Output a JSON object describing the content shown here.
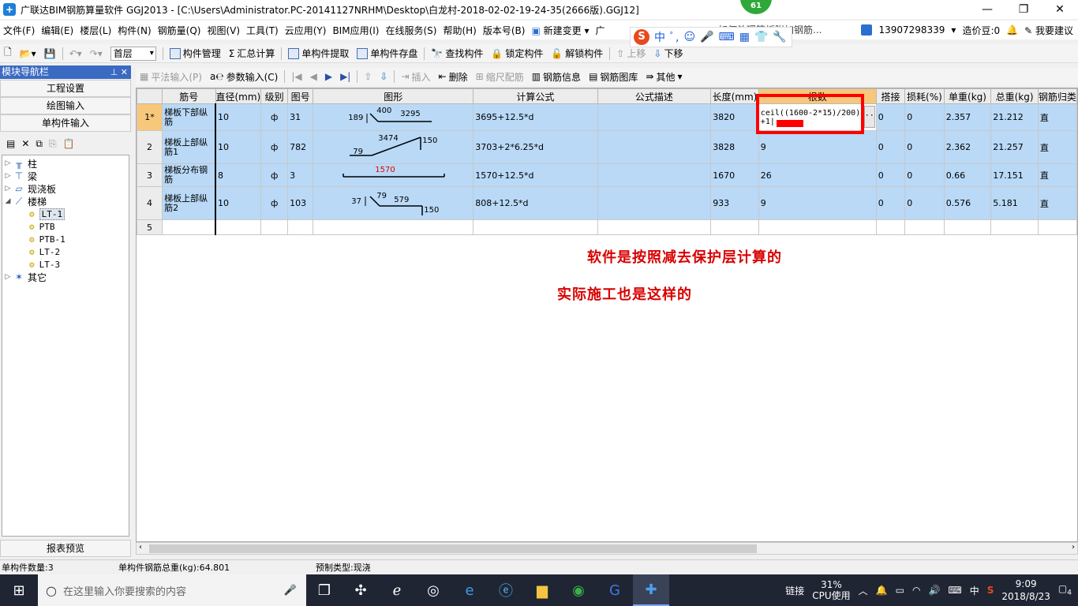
{
  "window": {
    "title": "广联达BIM钢筋算量软件 GGJ2013 - [C:\\Users\\Administrator.PC-20141127NRHM\\Desktop\\白龙村-2018-02-02-19-24-35(2666版).GGJ12]",
    "badge": "61"
  },
  "menu": {
    "items": [
      "文件(F)",
      "编辑(E)",
      "楼层(L)",
      "构件(N)",
      "钢筋量(Q)",
      "视图(V)",
      "工具(T)",
      "云应用(Y)",
      "BIM应用(I)",
      "在线服务(S)",
      "帮助(H)",
      "版本号(B)",
      "新建变更",
      "广"
    ],
    "hidden_tip": "如何处理筏板附加钢筋...",
    "phone": "13907298339",
    "price_bean": "造价豆:0",
    "suggest": "我要建议"
  },
  "ime": {
    "logo": "S",
    "lang": "中",
    "glyph": "ﾟ,"
  },
  "toolbar": {
    "floor": "首层",
    "component_manage": "构件管理",
    "sum_calc": "汇总计算",
    "single_extract": "单构件提取",
    "single_save": "单构件存盘",
    "find": "查找构件",
    "lock": "锁定构件",
    "unlock": "解锁构件",
    "move_up": "上移",
    "move_down": "下移"
  },
  "nav": {
    "title": "模块导航栏",
    "project_settings": "工程设置",
    "drawing_input": "绘图输入",
    "single_input": "单构件输入",
    "report_preview": "报表预览",
    "tree": [
      {
        "label": "柱",
        "icon": "column-icon"
      },
      {
        "label": "梁",
        "icon": "beam-icon"
      },
      {
        "label": "现浇板",
        "icon": "slab-icon"
      },
      {
        "label": "楼梯",
        "icon": "stair-icon"
      }
    ],
    "stairs": [
      "LT-1",
      "PTB",
      "PTB-1",
      "LT-2",
      "LT-3"
    ],
    "other": "其它"
  },
  "grid_toolbar": {
    "flat_input": "平法输入(P)",
    "param_input": "参数输入(C)",
    "insert": "插入",
    "delete": "删除",
    "scale": "缩尺配筋",
    "rebar_info": "钢筋信息",
    "rebar_lib": "钢筋图库",
    "other": "其他"
  },
  "grid": {
    "headers": [
      "筋号",
      "直径(mm)",
      "级别",
      "图号",
      "图形",
      "计算公式",
      "公式描述",
      "长度(mm)",
      "根数",
      "搭接",
      "损耗(%)",
      "单重(kg)",
      "总重(kg)",
      "钢筋归类"
    ],
    "rows": [
      {
        "num": "1*",
        "name": "梯板下部纵筋",
        "dia": "10",
        "grade": "ф",
        "fig": "31",
        "s1": "189",
        "s2": "400",
        "s3": "3295",
        "formula": "3695+12.5*d",
        "desc": "",
        "len": "3820",
        "count": "ceil((1600-2*15)/200)+1|",
        "lap": "0",
        "loss": "0",
        "unit": "2.357",
        "total": "21.212",
        "cls": "直"
      },
      {
        "num": "2",
        "name": "梯板上部纵筋1",
        "dia": "10",
        "grade": "ф",
        "fig": "782",
        "s1": "79",
        "s2": "3474",
        "s3": "150",
        "formula": "3703+2*6.25*d",
        "desc": "",
        "len": "3828",
        "count": "9",
        "lap": "0",
        "loss": "0",
        "unit": "2.362",
        "total": "21.257",
        "cls": "直"
      },
      {
        "num": "3",
        "name": "梯板分布钢筋",
        "dia": "8",
        "grade": "ф",
        "fig": "3",
        "s1": "1570",
        "s2": "",
        "s3": "",
        "formula": "1570+12.5*d",
        "desc": "",
        "len": "1670",
        "count": "26",
        "lap": "0",
        "loss": "0",
        "unit": "0.66",
        "total": "17.151",
        "cls": "直"
      },
      {
        "num": "4",
        "name": "梯板上部纵筋2",
        "dia": "10",
        "grade": "ф",
        "fig": "103",
        "s1": "37",
        "s2": "79",
        "s3": "579",
        "s4": "150",
        "formula": "808+12.5*d",
        "desc": "",
        "len": "933",
        "count": "9",
        "lap": "0",
        "loss": "0",
        "unit": "0.576",
        "total": "5.181",
        "cls": "直"
      }
    ],
    "empty_row": "5"
  },
  "annotations": {
    "line1": "软件是按照减去保护层计算的",
    "line2": "实际施工也是这样的"
  },
  "status": {
    "count": "单构件数量:3",
    "weight": "单构件钢筋总重(kg):64.801",
    "type": "预制类型:现浇"
  },
  "taskbar": {
    "search_placeholder": "在这里输入你要搜索的内容",
    "link": "链接",
    "cpu_pct": "31%",
    "cpu_label": "CPU使用",
    "lang": "中",
    "time": "9:09",
    "date": "2018/8/23",
    "notify": "4"
  },
  "colors": {
    "row_bg": "#b9d9f7",
    "header_active": "#f7c77c",
    "annotation": "#d80000",
    "nav_head": "#3b6ac2"
  }
}
